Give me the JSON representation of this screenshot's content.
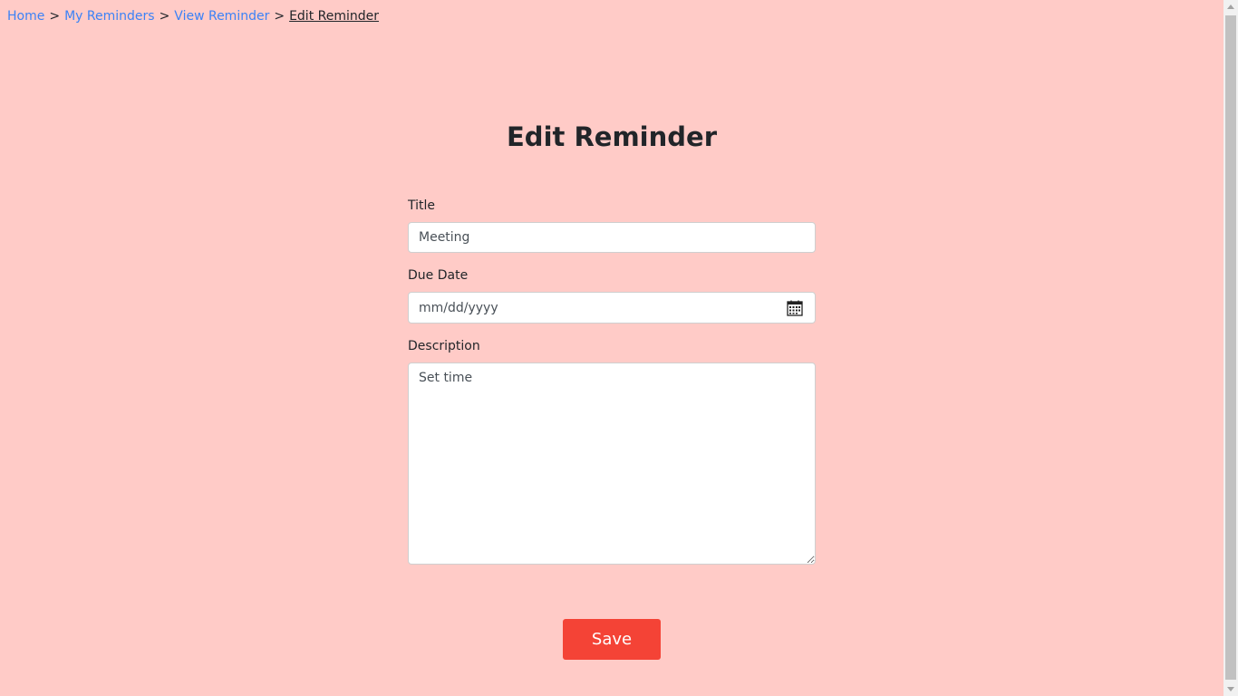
{
  "breadcrumb": {
    "items": [
      {
        "label": "Home"
      },
      {
        "label": "My Reminders"
      },
      {
        "label": "View Reminder"
      }
    ],
    "current": "Edit Reminder",
    "separator": ">"
  },
  "page": {
    "title": "Edit Reminder"
  },
  "form": {
    "title_label": "Title",
    "title_value": "Meeting",
    "due_date_label": "Due Date",
    "due_date_placeholder": "mm/dd/yyyy",
    "due_date_icon": "calendar-icon",
    "description_label": "Description",
    "description_value": "Set time"
  },
  "actions": {
    "save_label": "Save"
  },
  "colors": {
    "background": "#ffcbc7",
    "link": "#3b82f6",
    "save_button": "#f44336"
  }
}
